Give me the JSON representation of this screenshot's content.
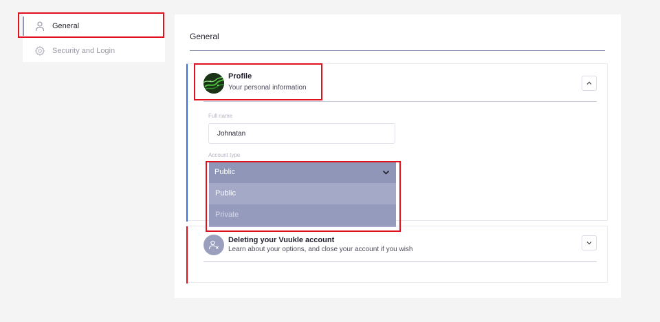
{
  "sidebar": {
    "items": [
      {
        "label": "General",
        "icon": "user-icon",
        "active": true
      },
      {
        "label": "Security and Login",
        "icon": "gear-icon",
        "active": false
      }
    ]
  },
  "main": {
    "title": "General",
    "profile": {
      "title": "Profile",
      "subtitle": "Your personal information",
      "avatar_icon": "avatar-image",
      "toggle_icon": "chevron-up-icon",
      "full_name_label": "Full name",
      "full_name_value": "Johnatan",
      "account_type_label": "Account type",
      "account_type_selected": "Public",
      "account_type_options": [
        "Public",
        "Private"
      ]
    },
    "delete_account": {
      "title": "Deleting your Vuukle account",
      "subtitle": "Learn about your options, and close your account if you wish",
      "icon": "user-remove-icon",
      "toggle_icon": "chevron-down-icon"
    }
  },
  "colors": {
    "highlight": "#e1101f",
    "profile_accent": "#3d6fe0",
    "select_header": "#8f96b8",
    "select_options": "#a3a9c7"
  }
}
